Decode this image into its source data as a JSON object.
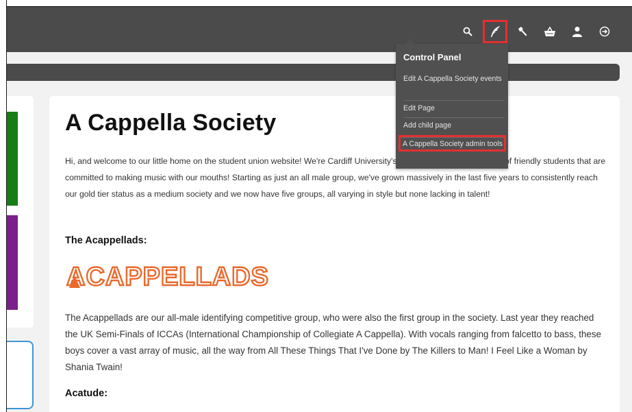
{
  "page": {
    "title": "A Cappella Society",
    "intro": "Hi, and welcome to our little home on the student union website! We're Cardiff University's A Cappella Society, a bunch of friendly students that are committed to making music with our mouths! Starting as just an all male group, we've grown massively in the last five years to consistently reach our gold tier status as a medium society and we now have five groups, all varying in style but none lacking in talent!",
    "section1_heading": "The Acappellads:",
    "logo_text": "ACAPPELLADS",
    "section1_body": "The Acappellads are our all-male identifying competitive group, who were also the first group in the society. Last year they reached the UK Semi-Finals of ICCAs (International Championship of Collegiate A Cappella). With vocals ranging from falcetto to bass, these boys cover a vast array of music, all the way from All These Things That I've Done by The Killers to Man! I Feel Like a Woman by Shania Twain!",
    "section2_heading": "Acatude:"
  },
  "toolbar": {
    "icons": [
      "search-icon",
      "quill-icon",
      "hammer-icon",
      "basket-icon",
      "user-icon",
      "logout-icon"
    ],
    "active_icon": "quill-icon"
  },
  "control_panel": {
    "title": "Control Panel",
    "items": [
      "Edit A Cappella Society events",
      "Edit Page",
      "Add child page",
      "A Cappella Society admin tools"
    ]
  },
  "colors": {
    "topbar": "#4b4b4b",
    "highlight": "#e53030",
    "logo": "#e9692c",
    "side_green": "#177d17",
    "side_purple": "#7b1f8a",
    "side_blue": "#3b96d6"
  }
}
